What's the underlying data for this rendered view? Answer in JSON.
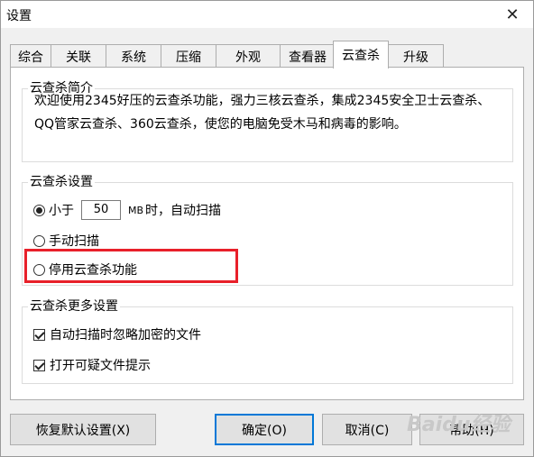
{
  "window": {
    "title": "设置",
    "close_glyph": "✕"
  },
  "tabs": [
    {
      "label": "综合"
    },
    {
      "label": "关联"
    },
    {
      "label": "系统"
    },
    {
      "label": "压缩"
    },
    {
      "label": "外观"
    },
    {
      "label": "查看器"
    },
    {
      "label": "云查杀",
      "active": true
    },
    {
      "label": "升级"
    }
  ],
  "intro": {
    "legend": "云查杀简介",
    "text": "欢迎使用2345好压的云查杀功能，强力三核云查杀，集成2345安全卫士云查杀、QQ管家云查杀、360云查杀，使您的电脑免受木马和病毒的影响。"
  },
  "settings": {
    "legend": "云查杀设置",
    "option_small_prefix": "小于",
    "size_value": "50",
    "size_unit": "MB",
    "option_small_suffix": "时，自动扫描",
    "option_manual": "手动扫描",
    "option_disable": "停用云查杀功能",
    "selected": "small"
  },
  "more": {
    "legend": "云查杀更多设置",
    "ignore_encrypted": {
      "label": "自动扫描时忽略加密的文件",
      "checked": true
    },
    "suspicious_tip": {
      "label": "打开可疑文件提示",
      "checked": true
    }
  },
  "buttons": {
    "restore_defaults": "恢复默认设置(X)",
    "ok": "确定(O)",
    "cancel": "取消(C)",
    "help": "帮助(H)"
  },
  "watermark": "Baidu经验",
  "colors": {
    "highlight": "#e8202a",
    "default_button_border": "#0078d7"
  }
}
